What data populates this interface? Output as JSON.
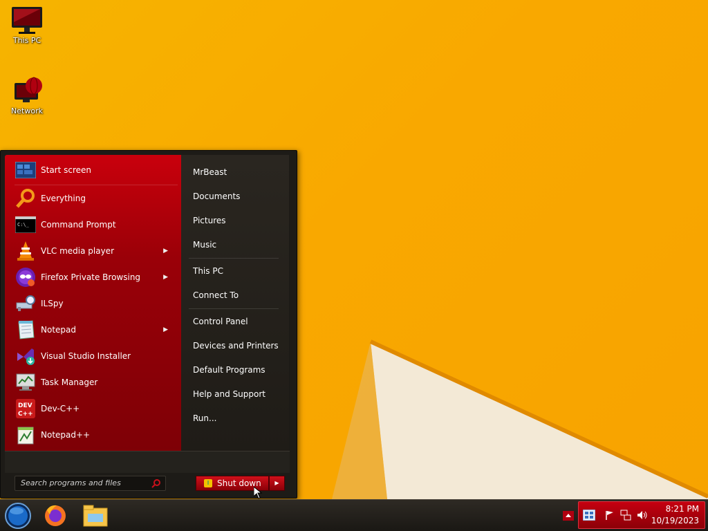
{
  "desktop": {
    "icons": [
      {
        "label": "This PC"
      },
      {
        "label": "Network"
      }
    ]
  },
  "start_menu": {
    "pinned": [
      {
        "label": "Start screen",
        "icon": "start-screen-icon"
      }
    ],
    "programs": [
      {
        "label": "Everything",
        "icon": "magnifier-icon",
        "submenu": false
      },
      {
        "label": "Command Prompt",
        "icon": "terminal-icon",
        "submenu": false
      },
      {
        "label": "VLC media player",
        "icon": "vlc-cone-icon",
        "submenu": true
      },
      {
        "label": "Firefox Private Browsing",
        "icon": "firefox-private-icon",
        "submenu": true
      },
      {
        "label": "ILSpy",
        "icon": "ilspy-icon",
        "submenu": false
      },
      {
        "label": "Notepad",
        "icon": "notepad-icon",
        "submenu": true
      },
      {
        "label": "Visual Studio Installer",
        "icon": "visual-studio-installer-icon",
        "submenu": false
      },
      {
        "label": "Task Manager",
        "icon": "task-manager-icon",
        "submenu": false
      },
      {
        "label": "Dev-C++",
        "icon": "devcpp-icon",
        "submenu": false
      },
      {
        "label": "Notepad++",
        "icon": "notepadpp-icon",
        "submenu": false
      }
    ],
    "places": [
      {
        "label": "MrBeast"
      },
      {
        "label": "Documents"
      },
      {
        "label": "Pictures"
      },
      {
        "label": "Music"
      },
      {
        "label": "This PC"
      },
      {
        "label": "Connect To"
      },
      {
        "label": "Control Panel"
      },
      {
        "label": "Devices and Printers"
      },
      {
        "label": "Default Programs"
      },
      {
        "label": "Help and Support"
      },
      {
        "label": "Run..."
      }
    ],
    "search": {
      "placeholder": "Search programs and files"
    },
    "shutdown": {
      "label": "Shut down"
    }
  },
  "taskbar": {
    "pinned_icons": [
      "start-orb-icon",
      "firefox-icon",
      "file-explorer-icon"
    ],
    "tray_icons": [
      "show-hidden-icon",
      "action-center-flag-icon",
      "network-icon",
      "volume-icon"
    ],
    "clock": {
      "time": "8:21 PM",
      "date": "10/19/2023"
    }
  },
  "colors": {
    "accent_red": "#c9000c",
    "wallpaper_orange": "#f9a800",
    "menu_dark": "#1d1b17"
  }
}
